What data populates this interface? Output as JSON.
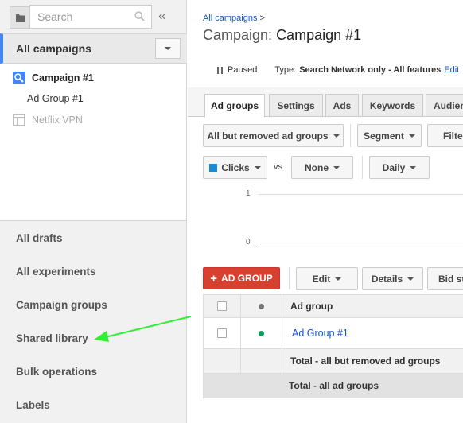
{
  "sidebar": {
    "search_placeholder": "Search",
    "collapse_label": "«",
    "all_campaigns_label": "All campaigns",
    "tree": {
      "campaign": "Campaign #1",
      "ad_group": "Ad Group #1",
      "netflix": "Netflix VPN"
    },
    "links": [
      "All drafts",
      "All experiments",
      "Campaign groups",
      "Shared library",
      "Bulk operations",
      "Labels"
    ]
  },
  "header": {
    "breadcrumb": "All campaigns",
    "breadcrumb_sep": ">",
    "title_prefix": "Campaign:",
    "title_name": "Campaign #1",
    "status": "Paused",
    "type_label": "Type:",
    "type_value": "Search Network only - All features",
    "edit_label": "Edit"
  },
  "tabs": [
    "Ad groups",
    "Settings",
    "Ads",
    "Keywords",
    "Audien"
  ],
  "toolbar": {
    "filter_dropdown": "All but removed ad groups",
    "segment": "Segment",
    "filter": "Filter",
    "metric1": "Clicks",
    "vs": "vs",
    "metric2": "None",
    "period": "Daily"
  },
  "chart_data": {
    "type": "line",
    "y_ticks": [
      "1",
      "0"
    ]
  },
  "actions": {
    "add_label": "AD GROUP",
    "edit": "Edit",
    "details": "Details",
    "bid": "Bid st"
  },
  "table": {
    "col_adgroup": "Ad group",
    "row_name": "Ad Group #1",
    "total_removed": "Total - all but removed ad groups",
    "total_all": "Total - all ad groups"
  },
  "colors": {
    "accent": "#4285f4",
    "link": "#1155cc",
    "add_button": "#d73f2e",
    "enabled_dot": "#0f9d58",
    "arrow": "#33ee33",
    "clicks_chip": "#1a8ad6"
  }
}
